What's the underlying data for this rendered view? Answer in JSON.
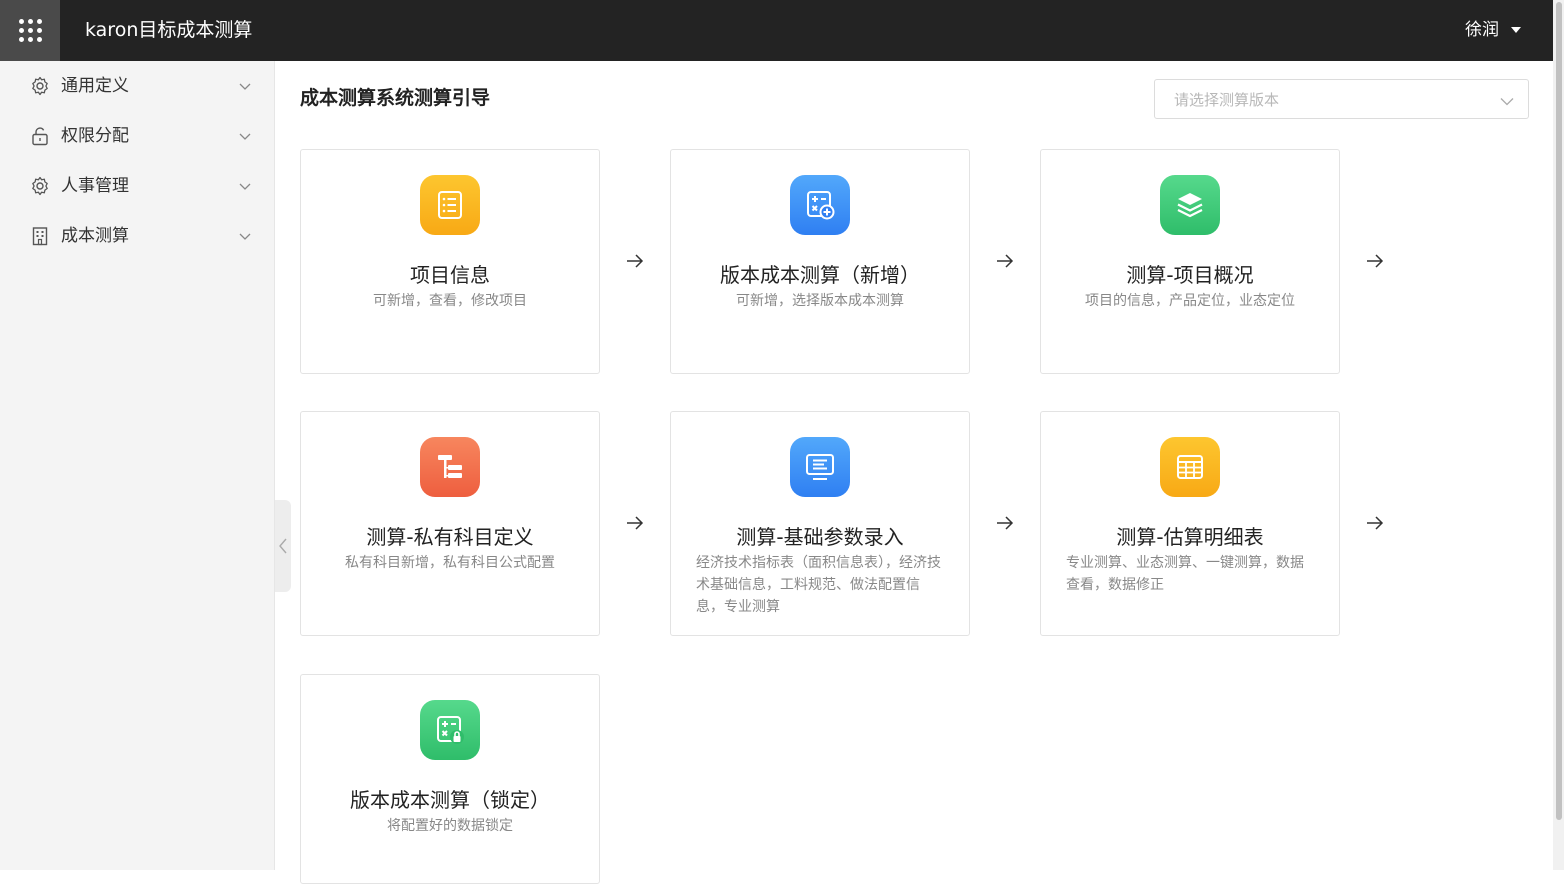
{
  "header": {
    "app_title": "karon目标成本测算",
    "user_name": "徐润",
    "apps_icon": "grid-dots-icon"
  },
  "sidebar": {
    "items": [
      {
        "label": "通用定义",
        "icon": "gear-icon"
      },
      {
        "label": "权限分配",
        "icon": "lock-icon"
      },
      {
        "label": "人事管理",
        "icon": "gear-icon"
      },
      {
        "label": "成本测算",
        "icon": "building-icon"
      }
    ]
  },
  "main": {
    "title": "成本测算系统测算引导",
    "version_select": {
      "placeholder": "请选择测算版本"
    },
    "cards": [
      {
        "title": "项目信息",
        "desc": "可新增，查看，修改项目",
        "icon": "list-document-icon",
        "color": "#fbb51f"
      },
      {
        "title": "版本成本测算（新增）",
        "desc": "可新增，选择版本成本测算",
        "icon": "calculator-add-icon",
        "color": "#3a8ef6"
      },
      {
        "title": "测算-项目概况",
        "desc": "项目的信息，产品定位，业态定位",
        "icon": "layers-icon",
        "color": "#3dcb7a"
      },
      {
        "title": "测算-私有科目定义",
        "desc": "私有科目新增，私有科目公式配置",
        "icon": "tree-structure-icon",
        "color": "#f1714d"
      },
      {
        "title": "测算-基础参数录入",
        "desc": "经济技术指标表（面积信息表），经济技术基础信息，工料规范、做法配置信息，专业测算",
        "icon": "monitor-list-icon",
        "color": "#3a8ef6"
      },
      {
        "title": "测算-估算明细表",
        "desc": "专业测算、业态测算、一键测算，数据查看，数据修正",
        "icon": "table-grid-icon",
        "color": "#fbb51f"
      },
      {
        "title": "版本成本测算（锁定）",
        "desc": "将配置好的数据锁定",
        "icon": "calculator-lock-icon",
        "color": "#3dcb7a"
      }
    ]
  }
}
